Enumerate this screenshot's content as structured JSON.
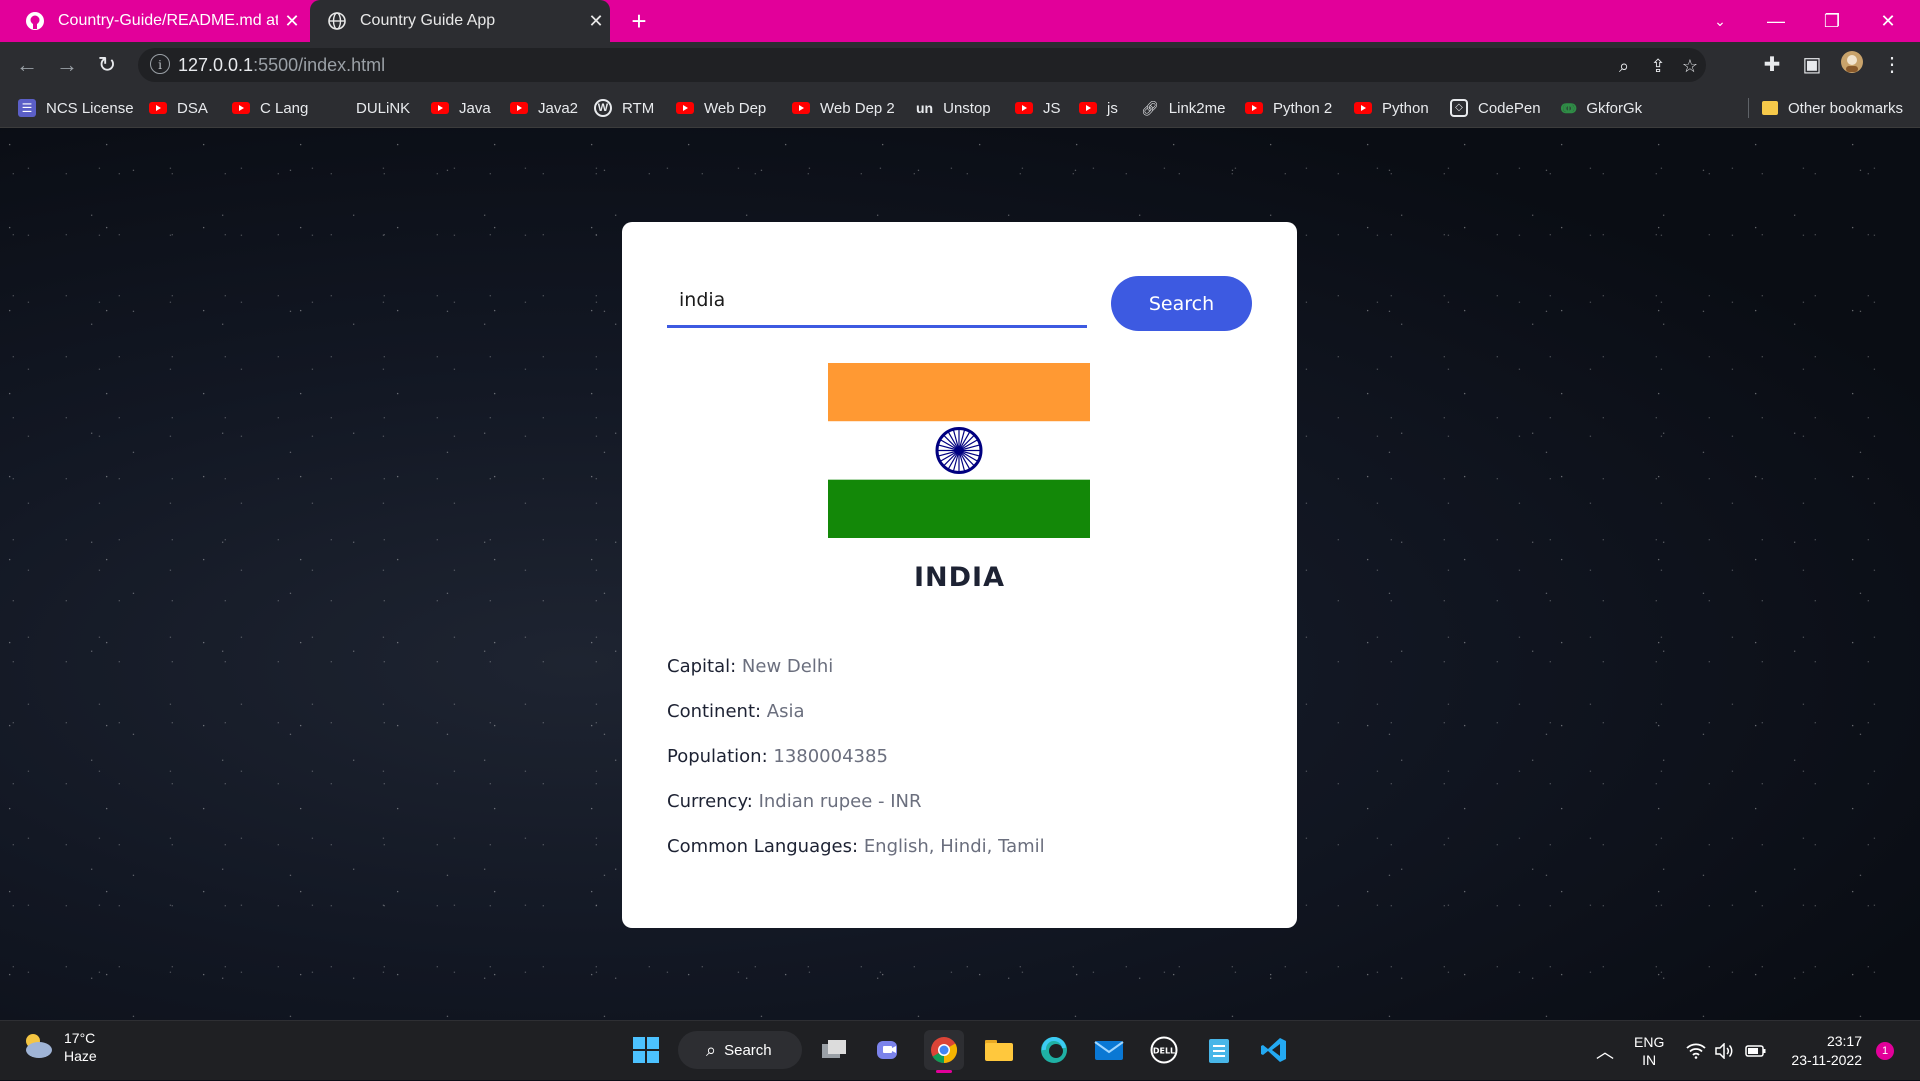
{
  "browser": {
    "tabs": [
      {
        "title": "Country-Guide/README.md at m",
        "icon": "github-icon",
        "active": false
      },
      {
        "title": "Country Guide App",
        "icon": "globe-icon",
        "active": true
      }
    ],
    "url_host": "127.0.0.1",
    "url_rest": ":5500/index.html",
    "bookmarks": [
      {
        "label": "NCS License",
        "icon": "list-icon"
      },
      {
        "label": "DSA",
        "icon": "youtube-icon"
      },
      {
        "label": "C Lang",
        "icon": "youtube-icon"
      },
      {
        "label": "DULiNK",
        "icon": "none"
      },
      {
        "label": "Java",
        "icon": "youtube-icon"
      },
      {
        "label": "Java2",
        "icon": "youtube-icon"
      },
      {
        "label": "RTM",
        "icon": "wordpress-icon"
      },
      {
        "label": "Web Dep",
        "icon": "youtube-icon"
      },
      {
        "label": "Web Dep 2",
        "icon": "youtube-icon"
      },
      {
        "label": "Unstop",
        "icon": "unstop-icon"
      },
      {
        "label": "JS",
        "icon": "youtube-icon"
      },
      {
        "label": "js",
        "icon": "youtube-icon"
      },
      {
        "label": "Link2me",
        "icon": "link-icon"
      },
      {
        "label": "Python 2",
        "icon": "youtube-icon"
      },
      {
        "label": "Python",
        "icon": "youtube-icon"
      },
      {
        "label": "CodePen",
        "icon": "codepen-icon"
      },
      {
        "label": "GkforGk",
        "icon": "gfg-icon"
      }
    ],
    "other_bookmarks": "Other bookmarks"
  },
  "app": {
    "search_value": "india",
    "search_button": "Search",
    "country": "INDIA",
    "info": [
      {
        "key": "Capital:",
        "value": "New Delhi"
      },
      {
        "key": "Continent:",
        "value": "Asia"
      },
      {
        "key": "Population:",
        "value": "1380004385"
      },
      {
        "key": "Currency:",
        "value": "Indian rupee - INR"
      },
      {
        "key": "Common Languages:",
        "value": "English, Hindi, Tamil"
      }
    ],
    "flag_colors": {
      "saffron": "#ff9933",
      "white": "#ffffff",
      "green": "#138808",
      "chakra": "#000080"
    }
  },
  "taskbar": {
    "weather_temp": "17°C",
    "weather_desc": "Haze",
    "search_label": "Search",
    "lang_top": "ENG",
    "lang_bottom": "IN",
    "time": "23:17",
    "date": "23-11-2022",
    "notification_count": "1"
  },
  "colors": {
    "tab_bar": "#e2009a",
    "accent": "#3d5ae1"
  }
}
